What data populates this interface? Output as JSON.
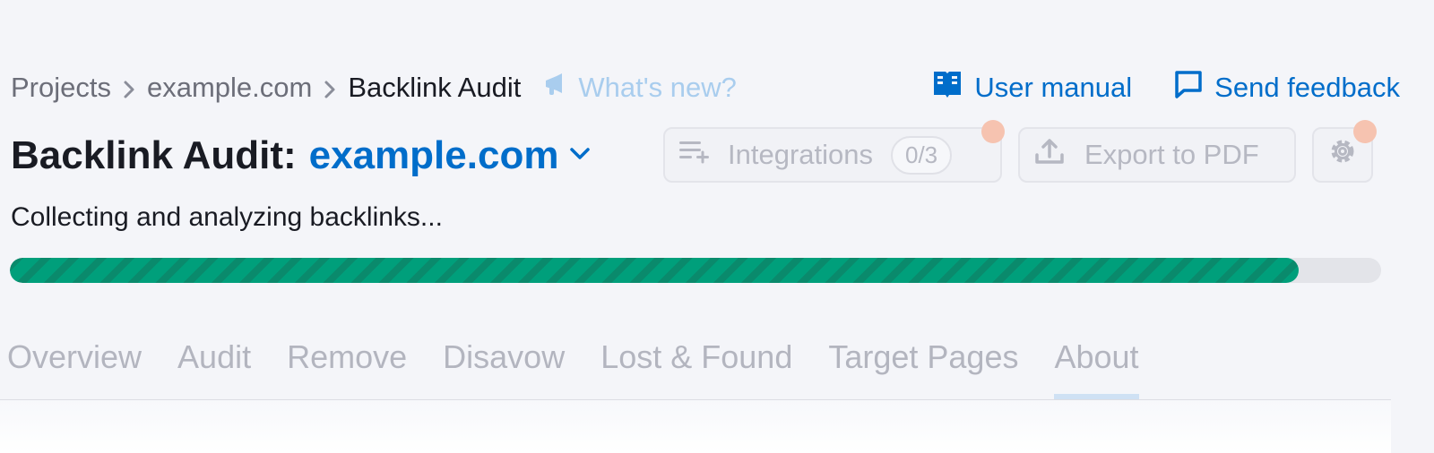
{
  "breadcrumb": {
    "items": [
      "Projects",
      "example.com",
      "Backlink Audit"
    ]
  },
  "header": {
    "whats_new": "What's new?",
    "user_manual": "User manual",
    "send_feedback": "Send feedback"
  },
  "title": {
    "prefix": "Backlink Audit:",
    "project": "example.com"
  },
  "buttons": {
    "integrations": "Integrations",
    "integrations_count": "0/3",
    "export": "Export to PDF"
  },
  "status": {
    "text": "Collecting and analyzing backlinks...",
    "progress_percent": 94
  },
  "tabs": [
    "Overview",
    "Audit",
    "Remove",
    "Disavow",
    "Lost & Found",
    "Target Pages",
    "About"
  ],
  "active_tab": "About",
  "colors": {
    "accent": "#006dca",
    "progress": "#009f7b",
    "notification": "#f6c3b0",
    "disabled_text": "#b6b8c2"
  },
  "icons": {
    "whats_new": "megaphone-icon",
    "user_manual": "book-icon",
    "send_feedback": "chat-bubble-icon",
    "integrations": "list-add-icon",
    "export": "upload-icon",
    "settings": "gear-icon",
    "dropdown": "chevron-down-icon",
    "breadcrumb_separator": "chevron-right-icon"
  }
}
